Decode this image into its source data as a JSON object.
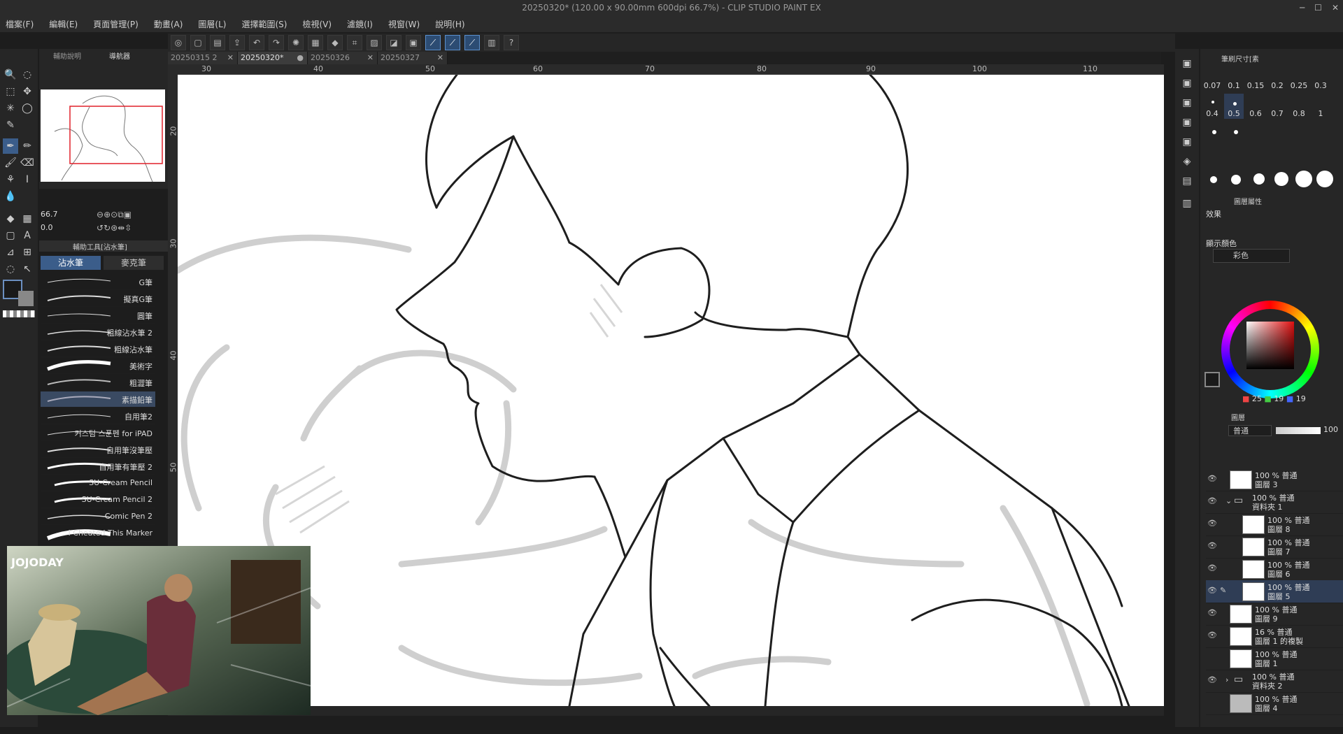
{
  "window": {
    "title": "20250320* (120.00 x 90.00mm 600dpi 66.7%)  - CLIP STUDIO PAINT EX"
  },
  "menu": [
    "檔案(F)",
    "編輯(E)",
    "頁面管理(P)",
    "動畫(A)",
    "圖層(L)",
    "選擇範圍(S)",
    "檢視(V)",
    "濾鏡(I)",
    "視窗(W)",
    "說明(H)"
  ],
  "tabs": [
    {
      "label": "20250315 2",
      "active": false
    },
    {
      "label": "20250320*",
      "active": true
    },
    {
      "label": "20250326",
      "active": false
    },
    {
      "label": "20250327",
      "active": false
    }
  ],
  "ruler": {
    "top": [
      "30",
      "40",
      "50",
      "60",
      "70",
      "80",
      "90",
      "100",
      "110"
    ],
    "left": [
      "20",
      "30",
      "40",
      "50"
    ]
  },
  "navigator": {
    "tab_label": "導航器",
    "tab2_label": "輔助說明",
    "zoom": "66.7",
    "rotation": "0.0"
  },
  "subtool": {
    "group_label": "輔助工具[沾水筆]",
    "tab_active": "沾水筆",
    "tab_other": "麥克筆",
    "brushes": [
      "G筆",
      "擬真G筆",
      "圓筆",
      "粗線沾水筆 2",
      "粗線沾水筆",
      "美術字",
      "粗澀筆",
      "素描鉛筆",
      "自用筆2",
      "커스텀 스푼펜 for iPAD",
      "自用筆沒筆壓",
      "自用筆有筆壓 2",
      "SU-Cream Pencil",
      "SU-Cream Pencil 2",
      "Comic Pen 2",
      "I Cheated This Marker"
    ],
    "selected": "素描鉛筆"
  },
  "brush_size_panel": {
    "title": "筆刷尺寸[素",
    "sizes": [
      "0.07",
      "0.1",
      "0.15",
      "0.2",
      "0.25",
      "0.3",
      "0.4",
      "0.5",
      "0.6",
      "0.7",
      "0.8",
      "1"
    ],
    "selected": "0.5"
  },
  "layer_property": {
    "title": "圖層屬性",
    "effect_label": "效果",
    "display_color_label": "顯示顏色",
    "display_color_value": "彩色"
  },
  "color": {
    "r": "25",
    "g": "19",
    "b": "19",
    "main": "#1a1a1a",
    "sub": "#888888"
  },
  "layers_panel": {
    "title": "圖層",
    "blend_mode": "普通",
    "opacity": "100",
    "layers": [
      {
        "pct": "100 %",
        "mode": "普通",
        "name": "圖層 3",
        "type": "layer",
        "visible": true,
        "indent": 0
      },
      {
        "pct": "100 %",
        "mode": "普通",
        "name": "資料夾 1",
        "type": "folder",
        "visible": true,
        "indent": 0
      },
      {
        "pct": "100 %",
        "mode": "普通",
        "name": "圖層 8",
        "type": "layer",
        "visible": true,
        "indent": 1
      },
      {
        "pct": "100 %",
        "mode": "普通",
        "name": "圖層 7",
        "type": "layer",
        "visible": true,
        "indent": 1
      },
      {
        "pct": "100 %",
        "mode": "普通",
        "name": "圖層 6",
        "type": "layer",
        "visible": true,
        "indent": 1
      },
      {
        "pct": "100 %",
        "mode": "普通",
        "name": "圖層 5",
        "type": "layer",
        "visible": true,
        "indent": 1,
        "selected": true
      },
      {
        "pct": "100 %",
        "mode": "普通",
        "name": "圖層 9",
        "type": "layer",
        "visible": true,
        "indent": 0
      },
      {
        "pct": "16 %",
        "mode": "普通",
        "name": "圖層 1 的複製",
        "type": "layer",
        "visible": true,
        "indent": 0
      },
      {
        "pct": "100 %",
        "mode": "普通",
        "name": "圖層 1",
        "type": "layer",
        "visible": false,
        "indent": 0
      },
      {
        "pct": "100 %",
        "mode": "普通",
        "name": "資料夾 2",
        "type": "folder",
        "visible": true,
        "indent": 0
      },
      {
        "pct": "100 %",
        "mode": "普通",
        "name": "圖層 4",
        "type": "layer",
        "visible": false,
        "indent": 0
      }
    ]
  },
  "video_overlay": {
    "logo": "JOJODAY"
  }
}
